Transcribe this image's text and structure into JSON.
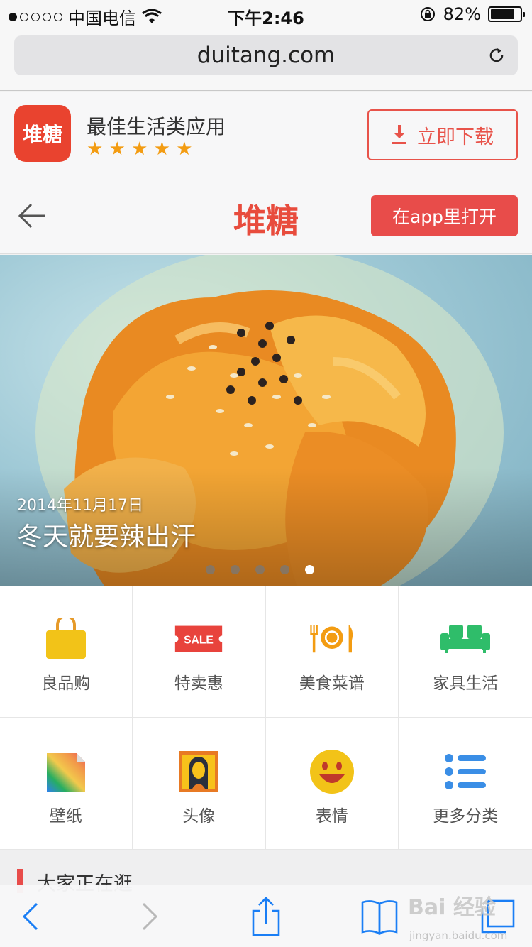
{
  "status_bar": {
    "carrier": "中国电信",
    "time": "下午2:46",
    "battery": "82%",
    "battery_level": 0.82,
    "signal_bars_filled": 1
  },
  "browser": {
    "url": "duitang.com"
  },
  "app_banner": {
    "app_icon_text": "堆糖",
    "title": "最佳生活类应用",
    "rating_stars": 5,
    "stars": "★ ★ ★ ★ ★",
    "download_label": "立即下载"
  },
  "header": {
    "brand": "堆糖",
    "open_in_app_label": "在app里打开"
  },
  "hero": {
    "date": "2014年11月17日",
    "title": "冬天就要辣出汗",
    "pages": 5,
    "active_page": 5
  },
  "categories": [
    {
      "label": "良品购",
      "icon": "shopping-bag-icon"
    },
    {
      "label": "特卖惠",
      "icon": "sale-ticket-icon",
      "icon_text": "SALE"
    },
    {
      "label": "美食菜谱",
      "icon": "fork-plate-knife-icon"
    },
    {
      "label": "家具生活",
      "icon": "sofa-icon"
    },
    {
      "label": "壁纸",
      "icon": "wallpaper-icon"
    },
    {
      "label": "头像",
      "icon": "avatar-portrait-icon"
    },
    {
      "label": "表情",
      "icon": "smiley-face-icon"
    },
    {
      "label": "更多分类",
      "icon": "list-icon"
    }
  ],
  "section": {
    "title": "大家正在逛"
  },
  "watermark": {
    "text": "Bai 经验",
    "sub": "jingyan.baidu.com"
  },
  "colors": {
    "brand_red": "#e84c3d",
    "star_orange": "#f39c12",
    "ios_blue": "#1a7ef5"
  }
}
